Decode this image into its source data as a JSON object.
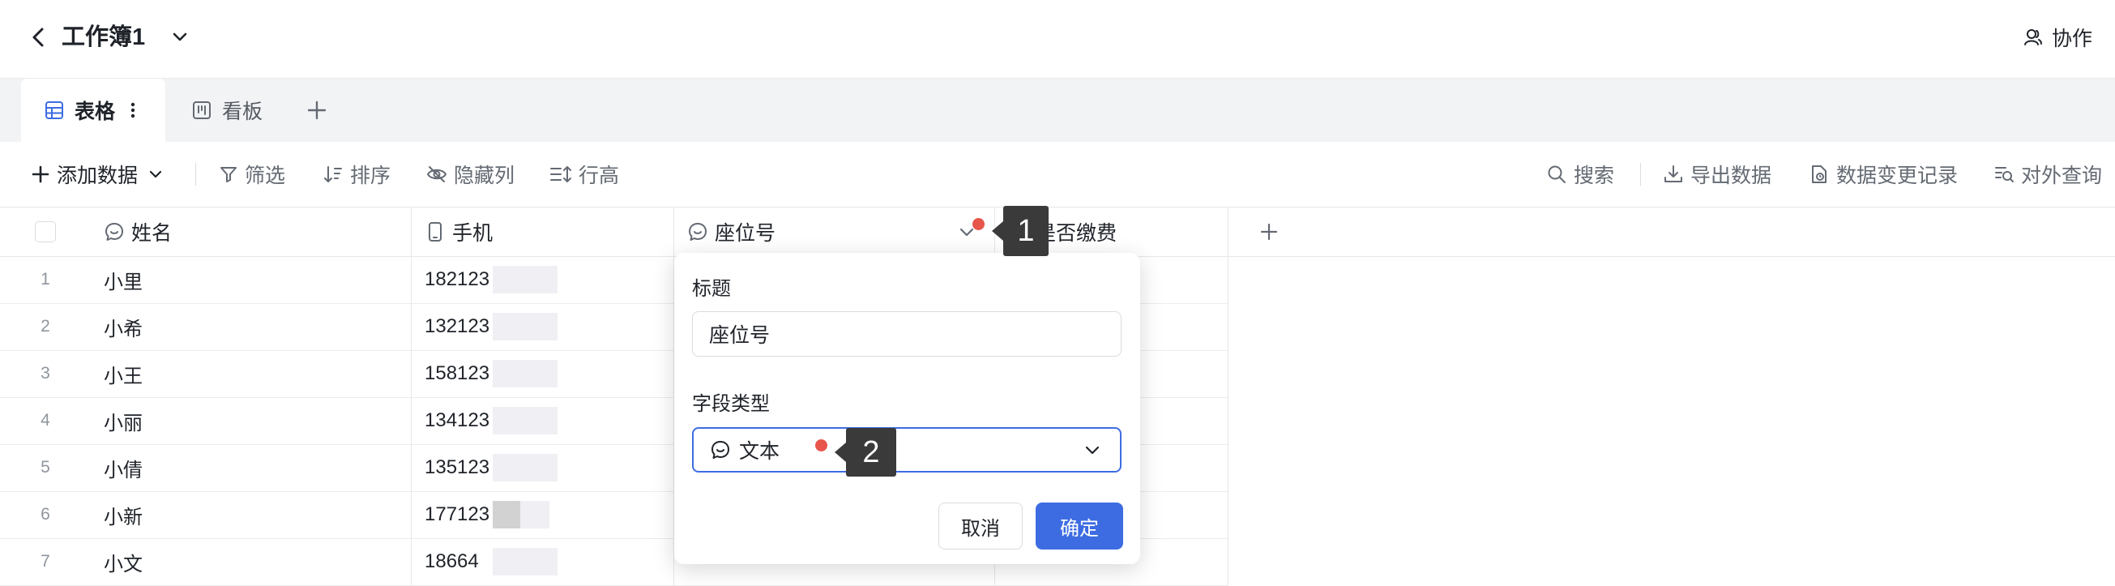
{
  "header": {
    "workbook_title": "工作簿1",
    "collab_label": "协作"
  },
  "tabs": [
    {
      "label": "表格",
      "active": true
    },
    {
      "label": "看板",
      "active": false
    }
  ],
  "toolbar": {
    "add_data": "添加数据",
    "filter": "筛选",
    "sort": "排序",
    "hide_cols": "隐藏列",
    "row_height": "行高",
    "search": "搜索",
    "export": "导出数据",
    "change_log": "数据变更记录",
    "public_query": "对外查询"
  },
  "columns": [
    {
      "label": "姓名",
      "icon": "text-field-icon"
    },
    {
      "label": "手机",
      "icon": "phone-field-icon"
    },
    {
      "label": "座位号",
      "icon": "text-field-icon"
    },
    {
      "label": "是否缴费",
      "icon": "option-field-icon"
    }
  ],
  "rows": [
    {
      "index": "1",
      "name": "小里",
      "phone": "182123"
    },
    {
      "index": "2",
      "name": "小希",
      "phone": "132123"
    },
    {
      "index": "3",
      "name": "小王",
      "phone": "158123"
    },
    {
      "index": "4",
      "name": "小丽",
      "phone": "134123"
    },
    {
      "index": "5",
      "name": "小倩",
      "phone": "135123"
    },
    {
      "index": "6",
      "name": "小新",
      "phone": "177123"
    },
    {
      "index": "7",
      "name": "小文",
      "phone": "18664"
    }
  ],
  "popover": {
    "title_label": "标题",
    "title_value": "座位号",
    "type_label": "字段类型",
    "type_value": "文本",
    "cancel": "取消",
    "confirm": "确定"
  },
  "markers": {
    "m1": "1",
    "m2": "2"
  },
  "colors": {
    "accent": "#3d6ce2",
    "marker_dot": "#e8554a",
    "marker_bg": "#3a3a3a"
  }
}
